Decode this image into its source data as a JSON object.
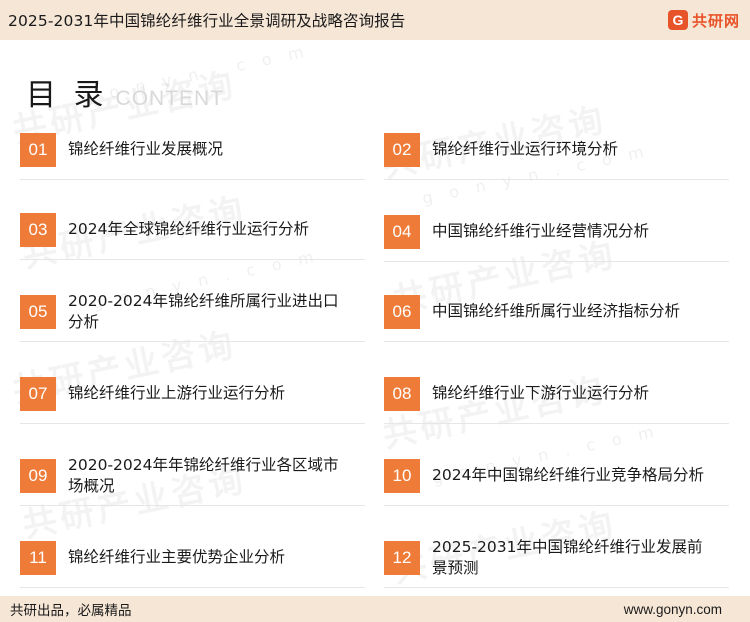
{
  "header": {
    "title": "2025-2031年中国锦纶纤维行业全景调研及战略咨询报告",
    "brand_mark": "G",
    "brand_name": "共研网"
  },
  "toc": {
    "title": "目 录",
    "subtitle": "CONTENT",
    "items": [
      {
        "number": "01",
        "text": "锦纶纤维行业发展概况"
      },
      {
        "number": "02",
        "text": "锦纶纤维行业运行环境分析"
      },
      {
        "number": "03",
        "text": "2024年全球锦纶纤维行业运行分析"
      },
      {
        "number": "04",
        "text": "中国锦纶纤维行业经营情况分析"
      },
      {
        "number": "05",
        "text": "2020-2024年锦纶纤维所属行业进出口分析"
      },
      {
        "number": "06",
        "text": "中国锦纶纤维所属行业经济指标分析"
      },
      {
        "number": "07",
        "text": "锦纶纤维行业上游行业运行分析"
      },
      {
        "number": "08",
        "text": "锦纶纤维行业下游行业运行分析"
      },
      {
        "number": "09",
        "text": "2020-2024年年锦纶纤维行业各区域市场概况"
      },
      {
        "number": "10",
        "text": "2024年中国锦纶纤维行业竞争格局分析"
      },
      {
        "number": "11",
        "text": "锦纶纤维行业主要优势企业分析"
      },
      {
        "number": "12",
        "text": "2025-2031年中国锦纶纤维行业发展前景预测"
      }
    ]
  },
  "watermark": {
    "text": "共研产业咨询",
    "url_text": "g o n y n . c o m"
  },
  "footer": {
    "slogan": "共研出品，必属精品",
    "url": "www.gonyn.com"
  },
  "colors": {
    "accent": "#ee7b38",
    "brand": "#e8542a",
    "bar_background": "#f6e6d6"
  }
}
